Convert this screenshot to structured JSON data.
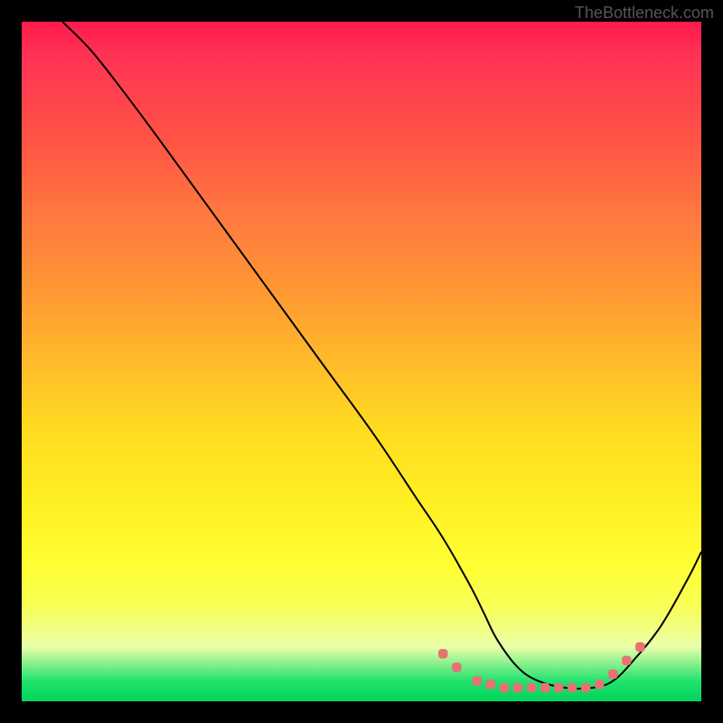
{
  "attribution": "TheBottleneck.com",
  "chart_data": {
    "type": "line",
    "title": "",
    "xlabel": "",
    "ylabel": "",
    "xlim": [
      0,
      100
    ],
    "ylim": [
      0,
      100
    ],
    "grid": false,
    "legend": false,
    "background": "rainbow-gradient-vertical",
    "series": [
      {
        "name": "bottleneck-curve",
        "color": "#000000",
        "x": [
          6,
          10,
          14,
          20,
          28,
          36,
          44,
          52,
          58,
          62,
          66,
          68,
          70,
          73,
          76,
          80,
          84,
          87,
          90,
          94,
          98,
          100
        ],
        "y": [
          100,
          96,
          91,
          83,
          72,
          61,
          50,
          39,
          30,
          24,
          17,
          13,
          9,
          5,
          3,
          2,
          2,
          3,
          6,
          11,
          18,
          22
        ]
      }
    ],
    "markers": {
      "name": "optimal-range",
      "color": "#e57373",
      "shape": "rounded-square",
      "points": [
        {
          "x": 62,
          "y": 7
        },
        {
          "x": 64,
          "y": 5
        },
        {
          "x": 67,
          "y": 3
        },
        {
          "x": 69,
          "y": 2.5
        },
        {
          "x": 71,
          "y": 2
        },
        {
          "x": 73,
          "y": 2
        },
        {
          "x": 75,
          "y": 2
        },
        {
          "x": 77,
          "y": 2
        },
        {
          "x": 79,
          "y": 2
        },
        {
          "x": 81,
          "y": 2
        },
        {
          "x": 83,
          "y": 2
        },
        {
          "x": 85,
          "y": 2.5
        },
        {
          "x": 87,
          "y": 4
        },
        {
          "x": 89,
          "y": 6
        },
        {
          "x": 91,
          "y": 8
        }
      ]
    }
  }
}
